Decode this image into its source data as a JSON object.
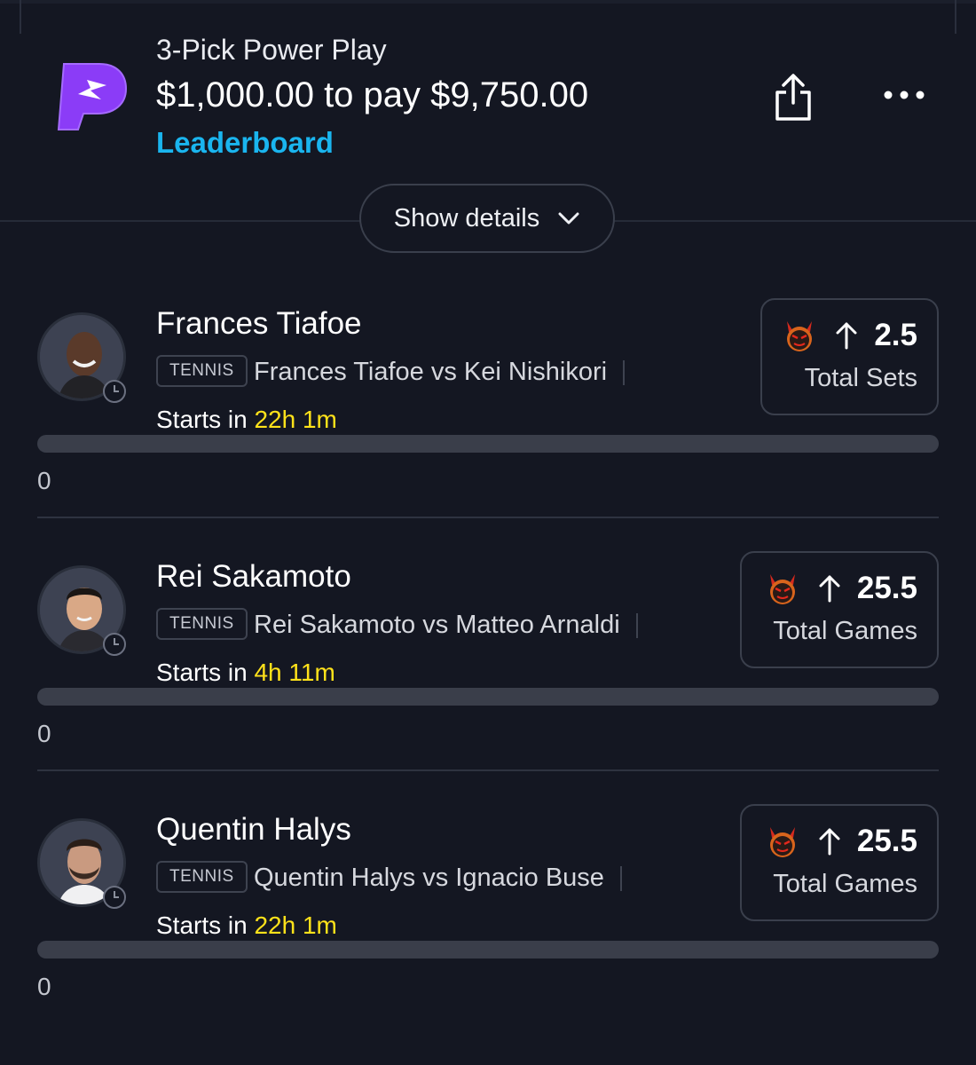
{
  "header": {
    "play_type": "3-Pick Power Play",
    "stake_line": "$1,000.00 to pay $9,750.00",
    "leaderboard_link": "Leaderboard",
    "share_icon": "share-icon",
    "more_icon": "more-dots-icon"
  },
  "details_button": {
    "label": "Show details",
    "icon": "chevron-down-icon"
  },
  "picks": [
    {
      "player": "Frances Tiafoe",
      "sport": "TENNIS",
      "matchup": "Frances Tiafoe vs Kei Nishikori",
      "start_prefix": "Starts in",
      "start_time": "22h 1m",
      "direction": "up",
      "line": "2.5",
      "stat": "Total Sets",
      "progress_value": "0",
      "progress_fraction": 0
    },
    {
      "player": "Rei Sakamoto",
      "sport": "TENNIS",
      "matchup": "Rei Sakamoto vs Matteo Arnaldi",
      "start_prefix": "Starts in",
      "start_time": "4h 11m",
      "direction": "up",
      "line": "25.5",
      "stat": "Total Games",
      "progress_value": "0",
      "progress_fraction": 0
    },
    {
      "player": "Quentin Halys",
      "sport": "TENNIS",
      "matchup": "Quentin Halys vs Ignacio Buse",
      "start_prefix": "Starts in",
      "start_time": "22h 1m",
      "direction": "up",
      "line": "25.5",
      "stat": "Total Games",
      "progress_value": "0",
      "progress_fraction": 0
    }
  ],
  "colors": {
    "background": "#141722",
    "accent_link": "#1ab5ef",
    "start_time": "#ffe21a",
    "brand_purple": "#7b3cf5"
  }
}
